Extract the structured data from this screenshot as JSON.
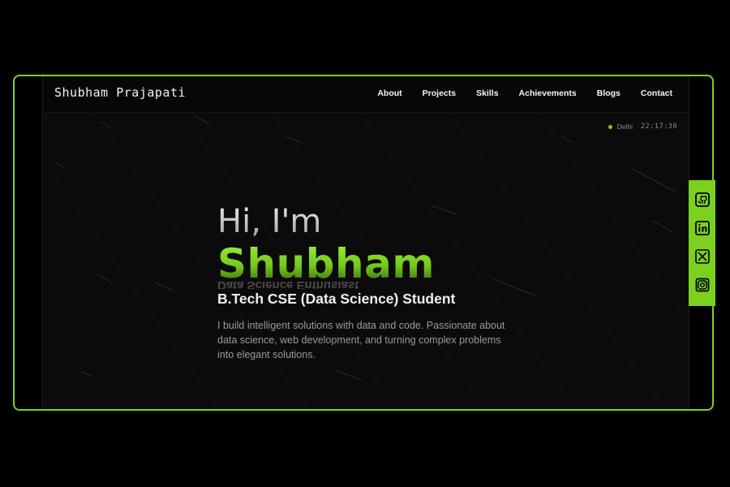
{
  "brand": {
    "name": "Shubham Prajapati"
  },
  "nav": {
    "items": [
      {
        "label": "About"
      },
      {
        "label": "Projects"
      },
      {
        "label": "Skills"
      },
      {
        "label": "Achievements"
      },
      {
        "label": "Blogs"
      },
      {
        "label": "Contact"
      }
    ]
  },
  "status": {
    "location": "Delhi",
    "time": "22:17:30",
    "dot_color": "#7cd11e"
  },
  "hero": {
    "greeting": "Hi, I'm",
    "name": "Shubham",
    "ghost_text": "Data Science Enthusiast",
    "subtitle": "B.Tech CSE (Data Science) Student",
    "bio": "I build intelligent solutions with data and code. Passionate about data science, web development, and turning complex problems into elegant solutions."
  },
  "social": {
    "items": [
      {
        "icon": "github-icon"
      },
      {
        "icon": "linkedin-icon"
      },
      {
        "icon": "x-twitter-icon"
      },
      {
        "icon": "instagram-icon"
      }
    ]
  },
  "theme": {
    "accent": "#7cd11e",
    "background": "#0b0b0b"
  }
}
